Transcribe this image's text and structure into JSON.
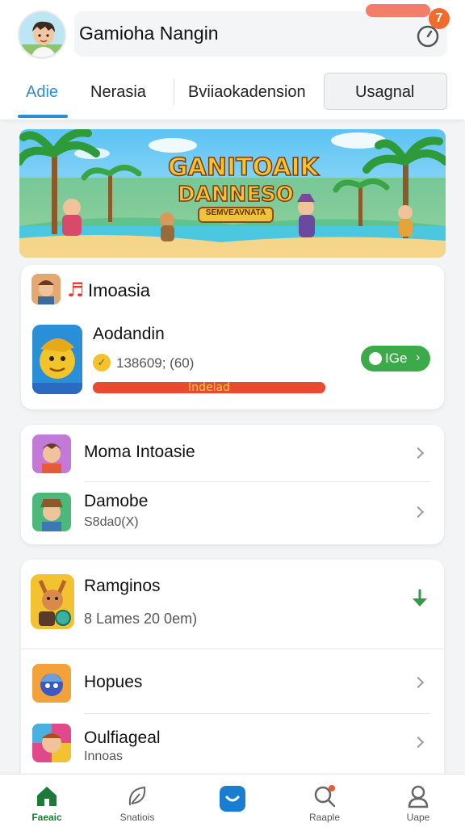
{
  "header": {
    "app_title": "Gamioha Nangin",
    "notification_count": "7",
    "tabs": [
      {
        "label": "Adie",
        "active": true
      },
      {
        "label": "Nerasia",
        "active": false
      },
      {
        "label": "Bviiaokadension",
        "active": false
      },
      {
        "label": "Usagnal",
        "active": false
      }
    ]
  },
  "banner": {
    "title_line1": "GANITOAIK",
    "title_line2": "DANNESO",
    "subtitle": "SEMVEAVNATA"
  },
  "featured": {
    "section_title": "Imoasia",
    "item_title": "Aodandin",
    "item_meta": "138609; (60)",
    "progress_label": "Indelad",
    "progress_value": 1.0,
    "button_label": "IGe"
  },
  "list_a": [
    {
      "title": "Moma Intoasie",
      "subtitle": ""
    },
    {
      "title": "Damobe",
      "subtitle": "S8da0(X)"
    }
  ],
  "list_b": [
    {
      "title": "Ramginos",
      "subtitle": "8 Lames 20 0em)"
    },
    {
      "title": "Hopues",
      "subtitle": ""
    },
    {
      "title": "Oulfiageal",
      "subtitle": "Innoas"
    }
  ],
  "bottom_nav": [
    {
      "label": "Faeaic",
      "icon": "home-icon",
      "active": true
    },
    {
      "label": "Snatiois",
      "icon": "leaf-icon",
      "active": false
    },
    {
      "label": "",
      "icon": "game-controller-icon",
      "active": false
    },
    {
      "label": "Raaple",
      "icon": "search-icon",
      "active": false
    },
    {
      "label": "Uape",
      "icon": "profile-icon",
      "active": false
    }
  ],
  "colors": {
    "accent": "#2c8fd6",
    "notification": "#f26b2c",
    "progress": "#ea4a2f",
    "button_green": "#3bab4a"
  }
}
